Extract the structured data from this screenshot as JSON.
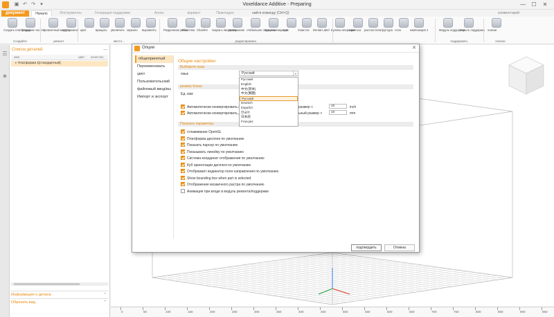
{
  "window": {
    "title": "Voxeldance Additive - Preparing",
    "minimize": "—",
    "maximize": "☐",
    "close": "✕"
  },
  "ribbon_tabs": {
    "file": "документ",
    "tabs": [
      "Начало",
      "Инструменты",
      "Генерация поддержки",
      "Анонс",
      "вариант",
      "Прикладно"
    ],
    "command_search": "найти команду (Ctrl+Q)",
    "feedback": "комментарий"
  },
  "ribbon": {
    "buttons": [
      "Создать платформу",
      "Создание частей",
      "ремонтный модуль",
      "авто ремонт",
      "цвет",
      "вращать",
      "увеличить",
      "зеркало",
      "выровнять",
      "Разделение резки",
      "Оболочка",
      "Chamfer",
      "лицом к лицевому",
      "протяжение",
      "глобальное смещение",
      "Удалить лицевую",
      "стоп",
      "Ушастое",
      "Dental Label",
      "Булевы операции",
      "сваяться",
      "растолстить",
      "структура",
      "соты",
      "композиция 2",
      "Модуль поддержки",
      "Скрыть поддержку",
      "поиски"
    ],
    "groups": [
      "Создайте",
      "ремонт",
      "место...",
      "редактировать",
      "поддержать",
      "поиски"
    ]
  },
  "left_panel": {
    "title": "Список деталей",
    "columns": [
      "имя",
      "цвет",
      "качество"
    ],
    "tree_item": "Платформа 1[стандартный]",
    "section_info": "Информация о детали",
    "section_view": "Обрезать вид"
  },
  "dialog": {
    "title": "Опции",
    "nav": [
      "общепринятый",
      "Переименовать",
      "цвет",
      "Пользовательский",
      "файловый ввод/вы",
      "Импорт и экспорт"
    ],
    "content_title": "Общие настройки",
    "lang_section": "Выберите язык",
    "lang_label": "язык",
    "lang_selected": "Русский",
    "lang_options": [
      "Русский",
      "English",
      "中文(简体)",
      "中文(繁體)",
      "Русский",
      "Deutsch",
      "Español",
      "한국어",
      "日本語",
      "Français"
    ],
    "unit_section": "размер блока",
    "unit_label": "Ед. изм",
    "auto_convert_1": "Автоматически конвертировать г",
    "auto_convert_1_tail": "размер <",
    "auto_convert_1_val": "40",
    "auto_convert_1_unit": "inch",
    "auto_convert_2": "Автоматически конвертировать д",
    "auto_convert_2_tail": "ьный размер >",
    "auto_convert_2_val": "10",
    "auto_convert_2_unit": "mm",
    "params_section": "Показать параметры",
    "params": [
      {
        "label": "сглаживание OpenGL",
        "checked": true
      },
      {
        "label": "Платформа дисплея по умолчанию",
        "checked": true
      },
      {
        "label": "Показать парсер по умолчанию",
        "checked": true
      },
      {
        "label": "Показывать линейку по умолчанию",
        "checked": true
      },
      {
        "label": "Система координат отображения по умолчанию",
        "checked": true
      },
      {
        "label": "Куб ориентации дисплея по умолчанию",
        "checked": true
      },
      {
        "label": "Отображает индикатор поля направления по умолчанию",
        "checked": true
      },
      {
        "label": "Show bounding box when part is selected",
        "checked": true
      },
      {
        "label": "Отображение мозаичного растра по умолчанию",
        "checked": true
      },
      {
        "label": "Анимация при входе в модуль ремонта/поддержки",
        "checked": false
      }
    ],
    "confirm": "подтвердить",
    "cancel": "Отмена"
  },
  "viewport": {
    "ruler_ticks": [
      "0",
      "50",
      "100",
      "150",
      "200",
      "250",
      "300",
      "350",
      "400",
      "450",
      "500",
      "550",
      "600",
      "650",
      "700",
      "750",
      "800",
      "850",
      "900",
      "950"
    ]
  },
  "colors": {
    "accent": "#f39a1e",
    "accent_text": "#e8890c",
    "selection": "#fde6c2"
  }
}
